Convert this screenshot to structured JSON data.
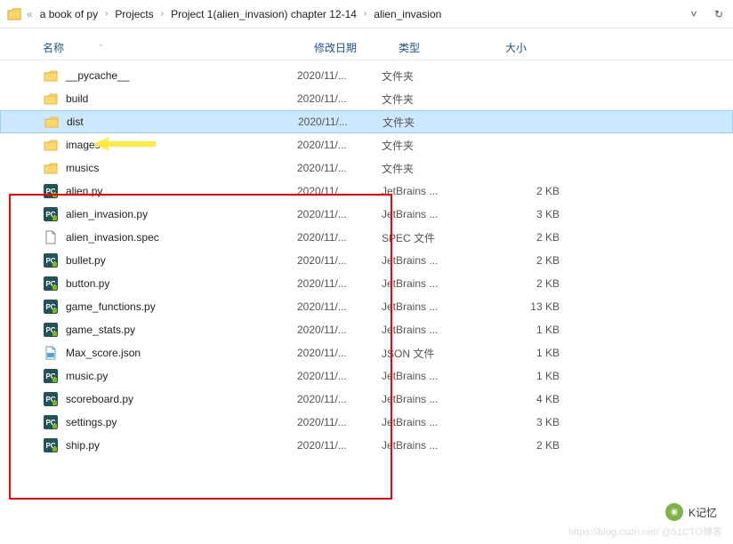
{
  "toolbar": {
    "back": "«",
    "crumbs": [
      "a book of py",
      "Projects",
      "Project 1(alien_invasion) chapter 12-14",
      "alien_invasion"
    ]
  },
  "headers": {
    "name": "名称",
    "date": "修改日期",
    "type": "类型",
    "size": "大小"
  },
  "rows": [
    {
      "icon": "folder",
      "name": "__pycache__",
      "date": "2020/11/...",
      "type": "文件夹",
      "size": ""
    },
    {
      "icon": "folder",
      "name": "build",
      "date": "2020/11/...",
      "type": "文件夹",
      "size": ""
    },
    {
      "icon": "folder",
      "name": "dist",
      "date": "2020/11/...",
      "type": "文件夹",
      "size": "",
      "selected": true
    },
    {
      "icon": "folder",
      "name": "images",
      "date": "2020/11/...",
      "type": "文件夹",
      "size": ""
    },
    {
      "icon": "folder",
      "name": "musics",
      "date": "2020/11/...",
      "type": "文件夹",
      "size": ""
    },
    {
      "icon": "py",
      "name": "alien.py",
      "date": "2020/11/...",
      "type": "JetBrains ...",
      "size": "2 KB"
    },
    {
      "icon": "py",
      "name": "alien_invasion.py",
      "date": "2020/11/...",
      "type": "JetBrains ...",
      "size": "3 KB"
    },
    {
      "icon": "file",
      "name": "alien_invasion.spec",
      "date": "2020/11/...",
      "type": "SPEC 文件",
      "size": "2 KB"
    },
    {
      "icon": "py",
      "name": "bullet.py",
      "date": "2020/11/...",
      "type": "JetBrains ...",
      "size": "2 KB"
    },
    {
      "icon": "py",
      "name": "button.py",
      "date": "2020/11/...",
      "type": "JetBrains ...",
      "size": "2 KB"
    },
    {
      "icon": "py",
      "name": "game_functions.py",
      "date": "2020/11/...",
      "type": "JetBrains ...",
      "size": "13 KB"
    },
    {
      "icon": "py",
      "name": "game_stats.py",
      "date": "2020/11/...",
      "type": "JetBrains ...",
      "size": "1 KB"
    },
    {
      "icon": "json",
      "name": "Max_score.json",
      "date": "2020/11/...",
      "type": "JSON 文件",
      "size": "1 KB"
    },
    {
      "icon": "py",
      "name": "music.py",
      "date": "2020/11/...",
      "type": "JetBrains ...",
      "size": "1 KB"
    },
    {
      "icon": "py",
      "name": "scoreboard.py",
      "date": "2020/11/...",
      "type": "JetBrains ...",
      "size": "4 KB"
    },
    {
      "icon": "py",
      "name": "settings.py",
      "date": "2020/11/...",
      "type": "JetBrains ...",
      "size": "3 KB"
    },
    {
      "icon": "py",
      "name": "ship.py",
      "date": "2020/11/...",
      "type": "JetBrains ...",
      "size": "2 KB"
    }
  ],
  "watermark": {
    "text": "K记忆",
    "url": "https://blog.csdn.net/  @51CTO博客"
  }
}
